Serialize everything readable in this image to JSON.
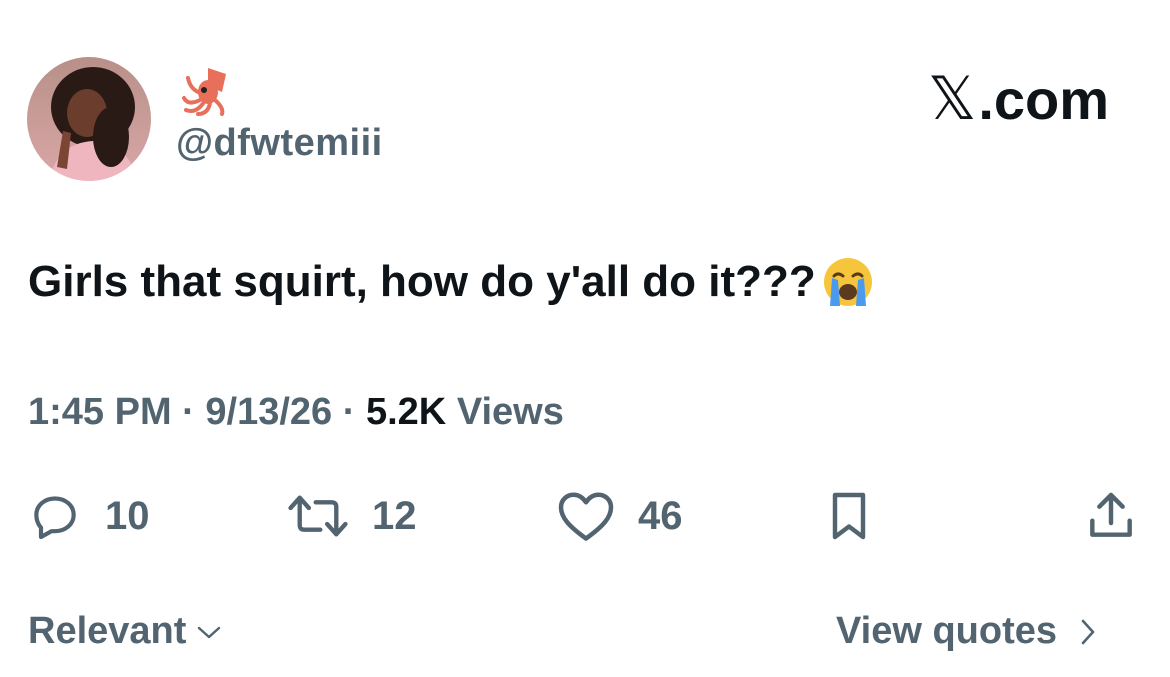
{
  "author": {
    "display_name_emoji": "squid-emoji",
    "handle": "@dfwtemiii"
  },
  "brand": {
    "x_glyph": "𝕏",
    "text": ".com"
  },
  "tweet": {
    "text": "Girls that squirt, how do y'all do it???",
    "emoji": "loudly-crying-face-emoji"
  },
  "meta": {
    "time": "1:45 PM",
    "sep1": " · ",
    "date": "9/13/26",
    "sep2": " · ",
    "views_count": "5.2K",
    "views_label": " Views"
  },
  "actions": {
    "replies": "10",
    "retweets": "12",
    "likes": "46"
  },
  "footer": {
    "sort_label": "Relevant",
    "quotes_label": "View quotes"
  },
  "colors": {
    "text_primary": "#0f1419",
    "text_secondary": "#536471"
  }
}
